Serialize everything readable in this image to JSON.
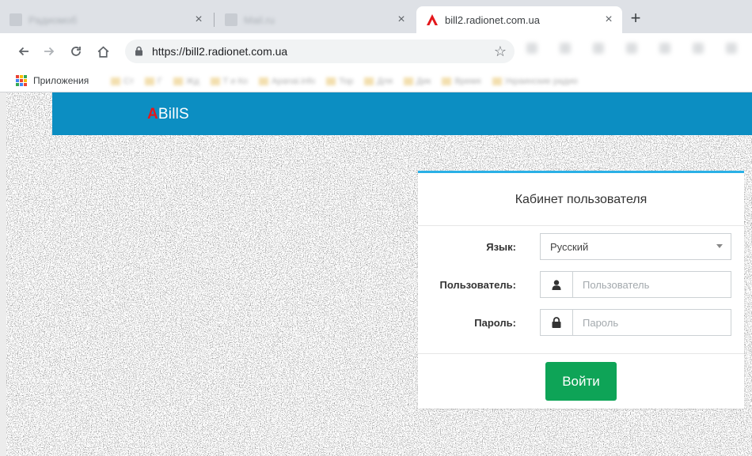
{
  "browser": {
    "tabs": [
      {
        "title": "Радиомоб",
        "active": false
      },
      {
        "title": "Mail.ru",
        "active": false
      },
      {
        "title": "bill2.radionet.com.ua",
        "active": true
      }
    ],
    "close_glyph": "×",
    "new_tab_glyph": "+",
    "url": "https://bill2.radionet.com.ua",
    "bookmarks_apps_label": "Приложения",
    "bookmarks": [
      "Ст",
      "Г",
      "Жд",
      "Т и Ко",
      "Apanai.info",
      "Тор",
      "Для",
      "Дик",
      "Время",
      "Украинские радио"
    ]
  },
  "app": {
    "logo_accent": "A",
    "logo_rest": "BillS",
    "brand_color": "#0c8ec2",
    "logo_accent_color": "#e3171b"
  },
  "login": {
    "title": "Кабинет пользователя",
    "language_label": "Язык:",
    "language_value": "Русский",
    "user_label": "Пользователь:",
    "user_placeholder": "Пользователь",
    "password_label": "Пароль:",
    "password_placeholder": "Пароль",
    "submit_label": "Войти",
    "submit_color": "#0ea457",
    "accent_border_color": "#2ab0e6"
  },
  "icons": {
    "back": "arrow-left-icon",
    "forward": "arrow-right-icon",
    "reload": "reload-icon",
    "home": "home-icon",
    "lock": "lock-icon",
    "star": "star-icon",
    "apps": "apps-grid-icon",
    "user": "user-icon",
    "password": "padlock-icon",
    "caret": "caret-down-icon"
  }
}
